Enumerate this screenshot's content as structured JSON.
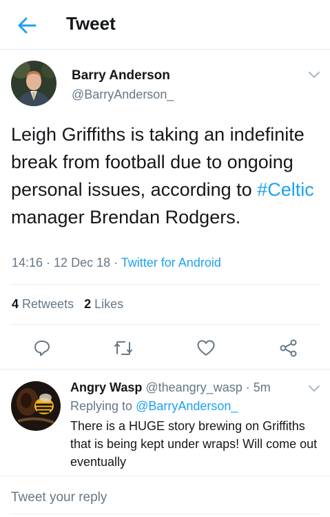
{
  "header": {
    "title": "Tweet",
    "back_icon": "arrow-left-icon",
    "accent": "#1da1f2"
  },
  "tweet": {
    "author": {
      "name": "Barry Anderson",
      "handle": "@BarryAnderson_"
    },
    "text_before": "Leigh Griffiths is taking an indefinite break from football due to ongoing personal issues, according to ",
    "hashtag": "#Celtic",
    "text_after": " manager Brendan Rodgers.",
    "time": "14:16",
    "sep1": " · ",
    "date": "12 Dec 18",
    "sep2": " · ",
    "source": "Twitter for Android",
    "retweets_count": "4",
    "retweets_label": "Retweets",
    "likes_count": "2",
    "likes_label": "Likes"
  },
  "actions": [
    "reply-icon",
    "retweet-icon",
    "like-icon",
    "share-icon"
  ],
  "reply": {
    "name": "Angry Wasp",
    "handle": "@theangry_wasp",
    "sep": " · ",
    "age": "5m",
    "replying_prefix": "Replying to ",
    "replying_to": "@BarryAnderson_",
    "text": "There is a HUGE story brewing on Griffiths that is being kept under wraps! Will come out eventually"
  },
  "composer": {
    "placeholder": "Tweet your reply"
  },
  "colors": {
    "text": "#14171a",
    "secondary": "#657786",
    "link": "#1da1f2",
    "divider": "#e6ecf0"
  }
}
